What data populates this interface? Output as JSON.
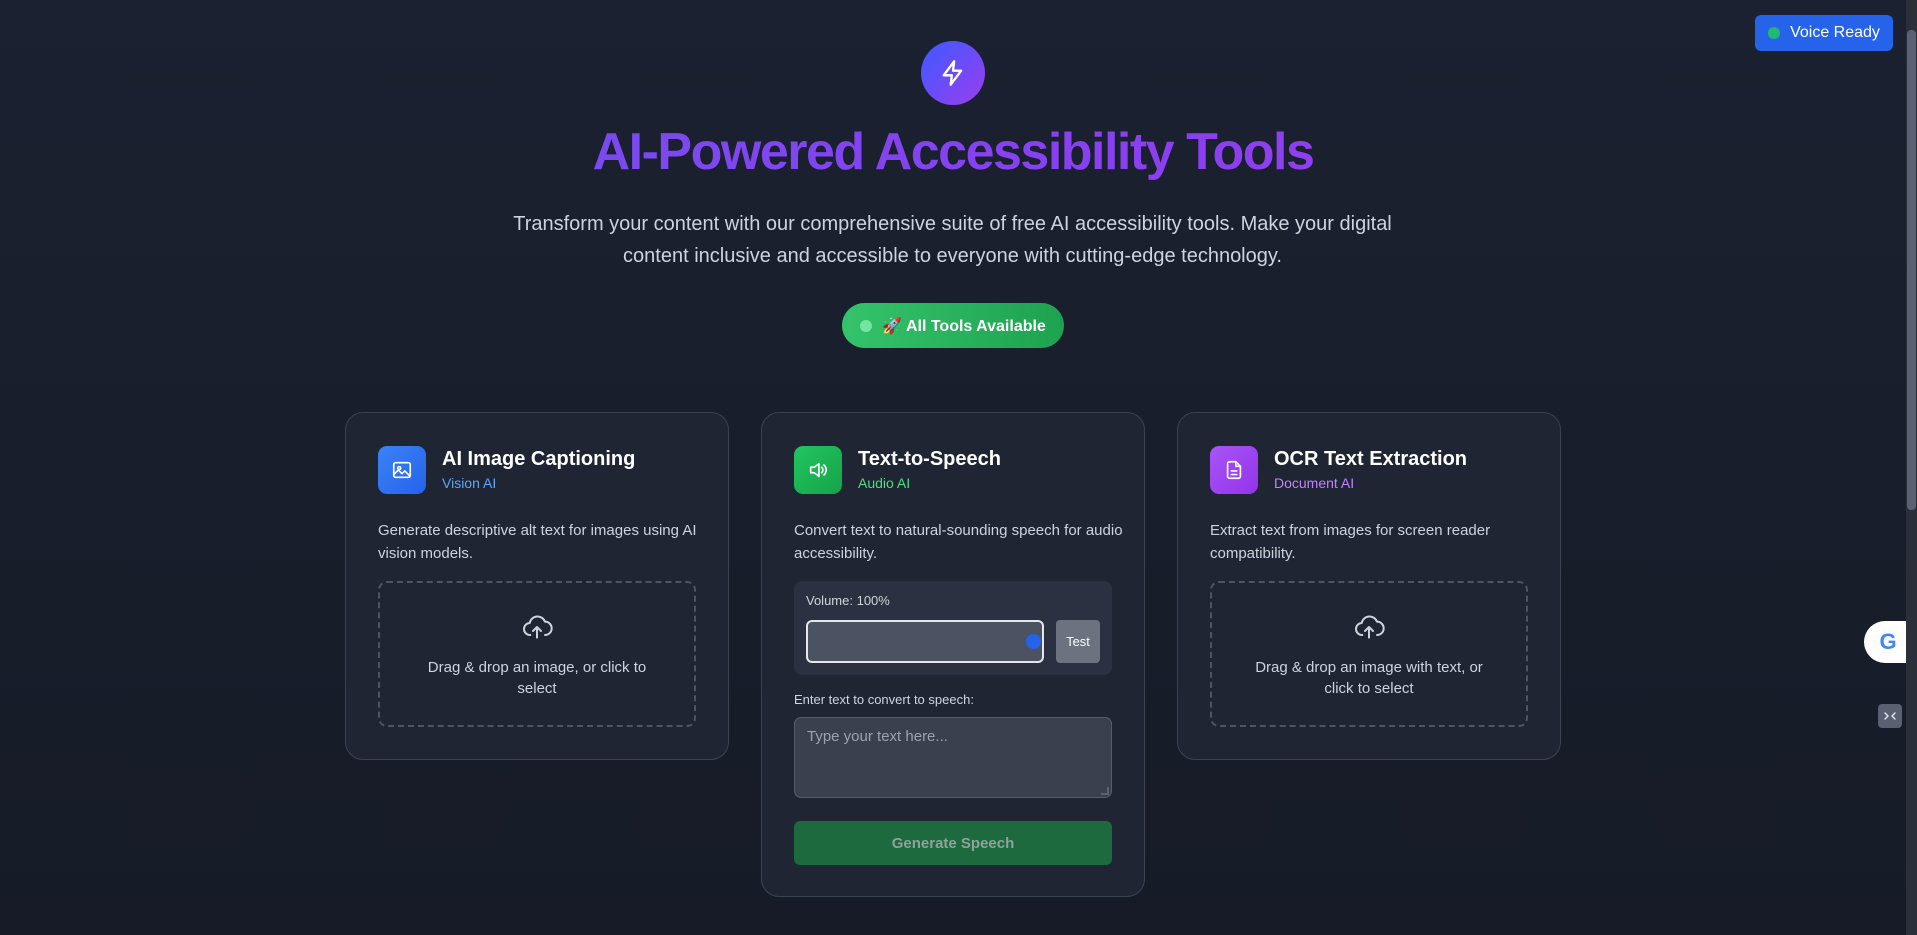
{
  "header": {
    "logo_icon": "lightning-icon",
    "title": "AI-Powered Accessibility Tools",
    "subtitle": "Transform your content with our comprehensive suite of free AI accessibility tools. Make your digital content inclusive and accessible to everyone with cutting-edge technology.",
    "status_pill": "🚀 All Tools Available"
  },
  "voice_badge": {
    "label": "Voice Ready"
  },
  "cards": {
    "captioning": {
      "icon": "image-icon",
      "title": "AI Image Captioning",
      "tag": "Vision AI",
      "description": "Generate descriptive alt text for images using AI vision models.",
      "dropzone_text": "Drag & drop an image, or click to select"
    },
    "tts": {
      "icon": "speaker-icon",
      "title": "Text-to-Speech",
      "tag": "Audio AI",
      "description": "Convert text to natural-sounding speech for audio accessibility.",
      "volume_label": "Volume: 100%",
      "volume_value": 100,
      "test_label": "Test",
      "text_label": "Enter text to convert to speech:",
      "text_placeholder": "Type your text here...",
      "generate_label": "Generate Speech"
    },
    "ocr": {
      "icon": "document-icon",
      "title": "OCR Text Extraction",
      "tag": "Document AI",
      "description": "Extract text from images for screen reader compatibility.",
      "dropzone_text": "Drag & drop an image with text, or click to select"
    }
  },
  "widgets": {
    "google_letter": "G"
  },
  "colors": {
    "accent_blue": "#2563eb",
    "accent_green": "#22c55e",
    "accent_purple": "#a855f7",
    "background": "#1b2130"
  }
}
